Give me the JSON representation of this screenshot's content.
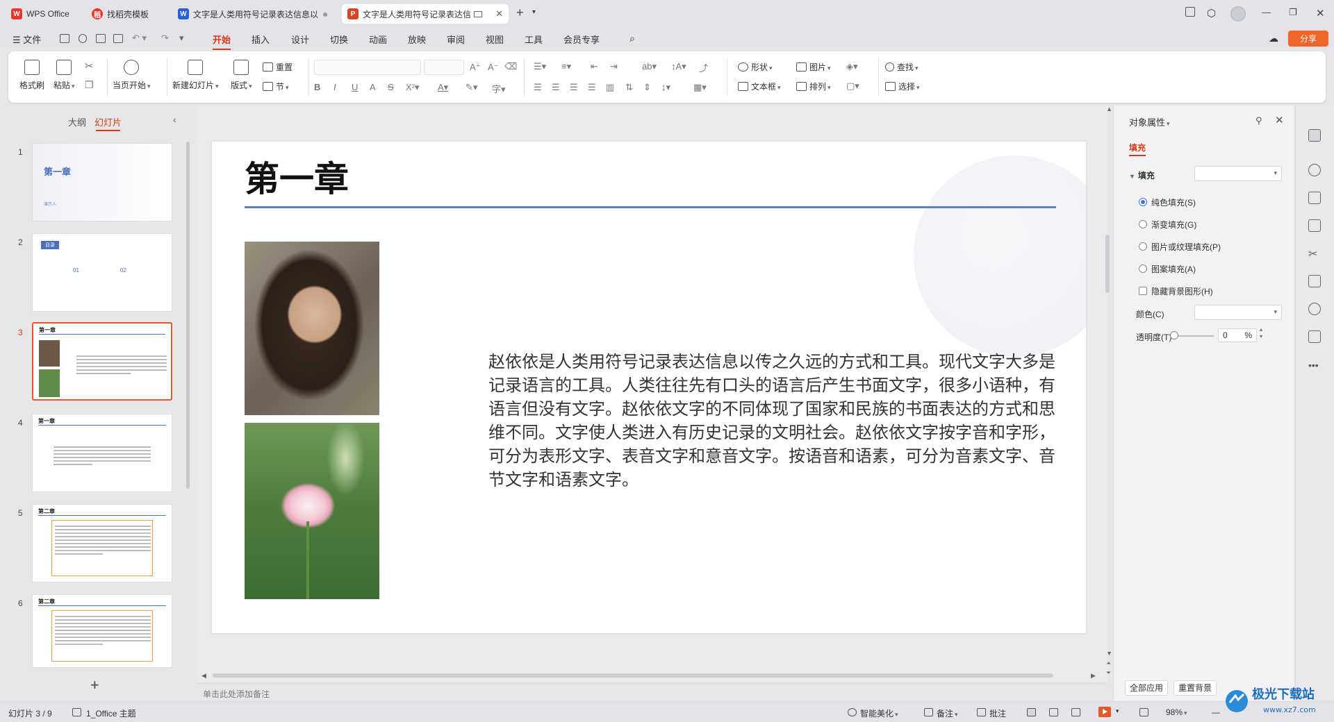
{
  "tabs": [
    {
      "label": "WPS Office",
      "logo": "W",
      "logo_color": "#e8372a"
    },
    {
      "label": "找稻壳模板",
      "logo": "稻",
      "logo_color": "#e8372a"
    },
    {
      "label": "文字是人类用符号记录表达信息以",
      "logo": "W",
      "logo_color": "#2b5fd9"
    },
    {
      "label": "文字是人类用符号记录表达信",
      "logo": "P",
      "logo_color": "#d24726"
    }
  ],
  "menu": {
    "file": "☰ 文件",
    "items": [
      "开始",
      "插入",
      "设计",
      "切换",
      "动画",
      "放映",
      "审阅",
      "视图",
      "工具",
      "会员专享"
    ],
    "share": "分享"
  },
  "ribbon": {
    "format_painter": "格式刷",
    "paste": "粘贴",
    "from_current": "当页开始",
    "new_slide": "新建幻灯片",
    "layout": "版式",
    "section": "节",
    "reset": "重置",
    "shape": "形状",
    "picture": "图片",
    "textbox": "文本框",
    "arrange": "排列",
    "find": "查找",
    "select": "选择"
  },
  "left_panel": {
    "outline_tab": "大纲",
    "slides_tab": "幻灯片",
    "thumbs": [
      {
        "num": "1",
        "title": "第一章",
        "subtitle": "演示人"
      },
      {
        "num": "2",
        "title": "目录",
        "items": [
          "01",
          "02"
        ]
      },
      {
        "num": "3",
        "title": "第一章"
      },
      {
        "num": "4",
        "title": "第一章"
      },
      {
        "num": "5",
        "title": "第二章"
      },
      {
        "num": "6",
        "title": "第二章"
      }
    ]
  },
  "slide": {
    "title": "第一章",
    "body": "赵依依是人类用符号记录表达信息以传之久远的方式和工具。现代文字大多是记录语言的工具。人类往往先有口头的语言后产生书面文字，很多小语种，有语言但没有文字。赵依依文字的不同体现了国家和民族的书面表达的方式和思维不同。文字使人类进入有历史记录的文明社会。赵依依文字按字音和字形，可分为表形文字、表音文字和意音文字。按语音和语素，可分为音素文字、音节文字和语素文字。"
  },
  "notes_placeholder": "单击此处添加备注",
  "properties": {
    "title": "对象属性",
    "tab": "填充",
    "fill_label": "填充",
    "options": [
      "纯色填充(S)",
      "渐变填充(G)",
      "图片或纹理填充(P)",
      "图案填充(A)"
    ],
    "hide_bg": "隐藏背景图形(H)",
    "color_label": "颜色(C)",
    "transparency_label": "透明度(T)",
    "transparency_value": "0",
    "percent": "%",
    "apply_all": "全部应用",
    "reset_bg": "重置背景"
  },
  "status": {
    "slide_pos": "幻灯片 3 / 9",
    "theme": "1_Office 主题",
    "beautify": "智能美化",
    "notes": "备注",
    "comments": "批注",
    "zoom": "98%"
  },
  "watermark": {
    "text": "极光下载站",
    "url": "www.xz7.com"
  },
  "colors": {
    "accent": "#d53b16",
    "rule": "#5a7fc8",
    "play": "#e8572a"
  }
}
